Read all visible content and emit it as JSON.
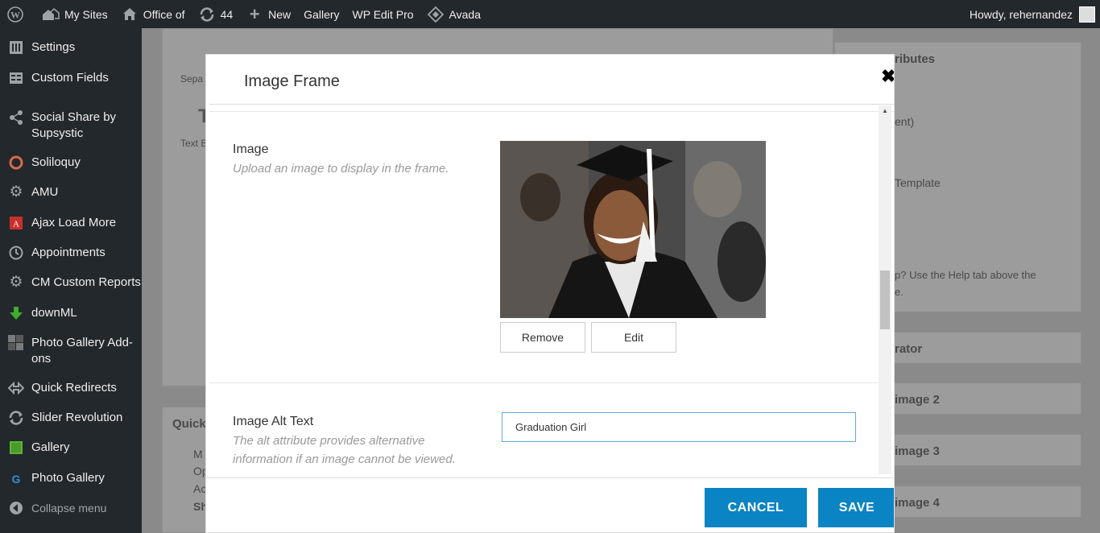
{
  "admin_bar": {
    "wp_logo": "wordpress-icon",
    "my_sites": "My Sites",
    "site_name": "Office of",
    "updates_count": "44",
    "new_label": "New",
    "gallery": "Gallery",
    "wp_edit_pro": "WP Edit Pro",
    "avada": "Avada",
    "howdy": "Howdy, rehernandez"
  },
  "sidebar": {
    "items": [
      {
        "label": "Settings",
        "icon": "settings-icon"
      },
      {
        "label": "Custom Fields",
        "icon": "custom-fields-icon"
      },
      {
        "label": "Social Share by Supsystic",
        "icon": "share-icon"
      },
      {
        "label": "Soliloquy",
        "icon": "soliloquy-icon"
      },
      {
        "label": "AMU",
        "icon": "gear-icon"
      },
      {
        "label": "Ajax Load More",
        "icon": "ajax-icon"
      },
      {
        "label": "Appointments",
        "icon": "clock-icon"
      },
      {
        "label": "CM Custom Reports",
        "icon": "gear-icon"
      },
      {
        "label": "downML",
        "icon": "download-icon"
      },
      {
        "label": "Photo Gallery Add-ons",
        "icon": "gallery-addons-icon"
      },
      {
        "label": "Quick Redirects",
        "icon": "redirect-icon"
      },
      {
        "label": "Slider Revolution",
        "icon": "refresh-icon"
      },
      {
        "label": "Gallery",
        "icon": "gallery-icon"
      },
      {
        "label": "Photo Gallery",
        "icon": "photo-gallery-icon"
      }
    ],
    "collapse": "Collapse menu"
  },
  "background": {
    "sep": "Sepa",
    "text_t": "T",
    "text_b": "Text B",
    "quick": "Quick",
    "attributes": "ributes",
    "parent": "ent)",
    "template": "Template",
    "help": "p? Use the Help tab above the",
    "help2": "e.",
    "generator": "rator",
    "image2": "image 2",
    "image3": "image 3",
    "image4": "image 4",
    "check_m": "M",
    "check_o": "Op",
    "check_a": "Ac",
    "check_s": "Sh"
  },
  "modal": {
    "title": "Image Frame",
    "image_label": "Image",
    "image_desc": "Upload an image to display in the frame.",
    "remove": "Remove",
    "edit": "Edit",
    "alt_label": "Image Alt Text",
    "alt_desc_1": "The alt attribute provides alternative",
    "alt_desc_2": "information if an image cannot be viewed.",
    "alt_value": "Graduation Girl",
    "cancel": "CANCEL",
    "save": "SAVE"
  },
  "colors": {
    "admin_bar": "#23282d",
    "primary_button": "#0a84c2",
    "input_focus": "#65a8d8"
  }
}
